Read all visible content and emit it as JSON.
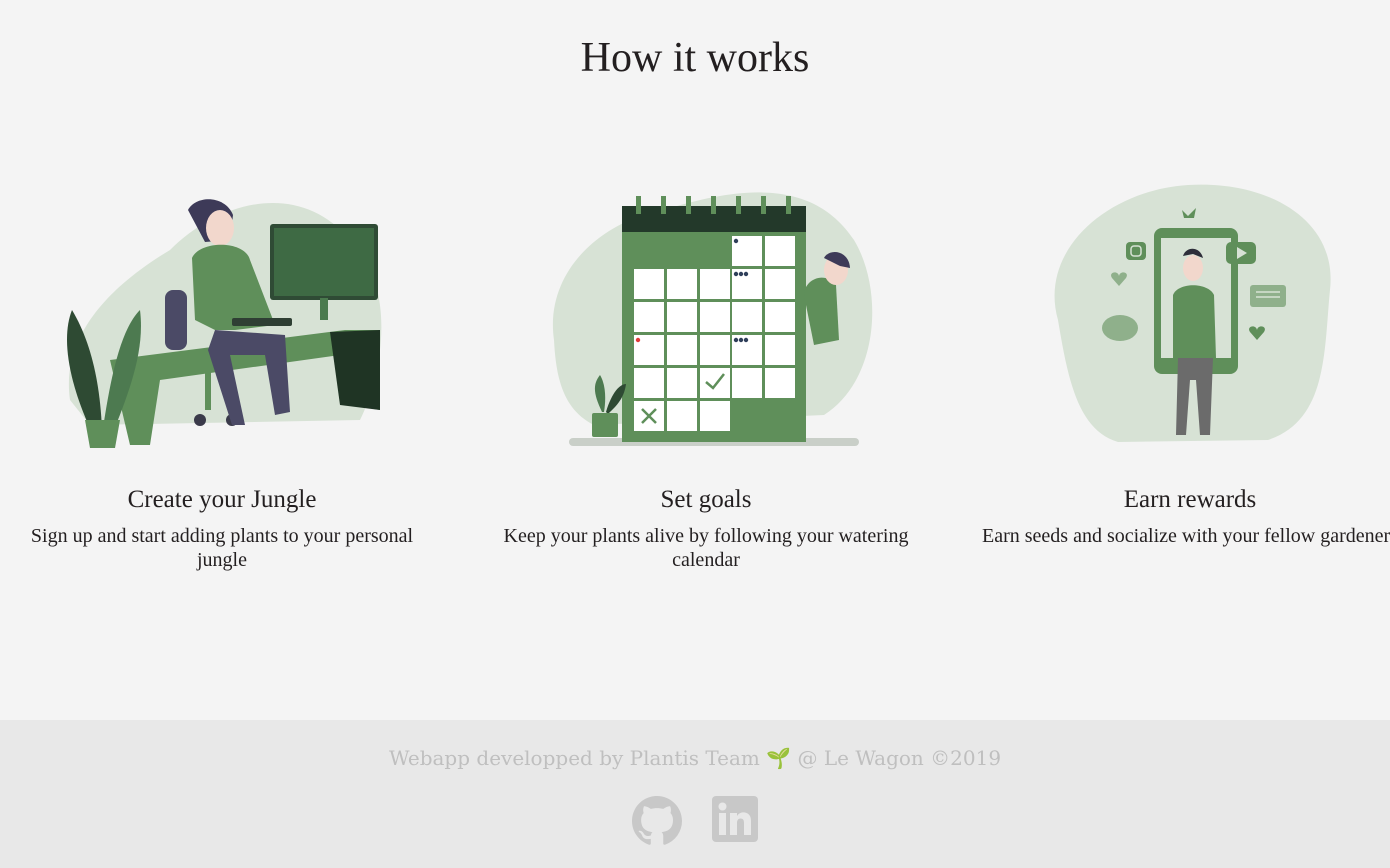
{
  "section": {
    "title": "How it works"
  },
  "cards": [
    {
      "title": "Create your Jungle",
      "text": "Sign up and start adding plants to your personal jungle",
      "icon": "person-at-desk-illustration"
    },
    {
      "title": "Set goals",
      "text": "Keep your plants alive by following your watering calendar",
      "icon": "watering-calendar-illustration"
    },
    {
      "title": "Earn rewards",
      "text": "Earn seeds and socialize with your fellow gardeners",
      "icon": "phone-social-illustration"
    }
  ],
  "footer": {
    "text": "Webapp developped by Plantis Team 🌱 @ Le Wagon ©2019",
    "links": [
      {
        "icon": "github-icon"
      },
      {
        "icon": "linkedin-icon"
      }
    ]
  },
  "colors": {
    "background": "#f4f4f4",
    "accent_green": "#5f8f5a",
    "dark_green": "#23392a",
    "blob": "#d7e2d5",
    "footer_bg": "#e8e8e8",
    "footer_text": "#bfbfbf"
  }
}
